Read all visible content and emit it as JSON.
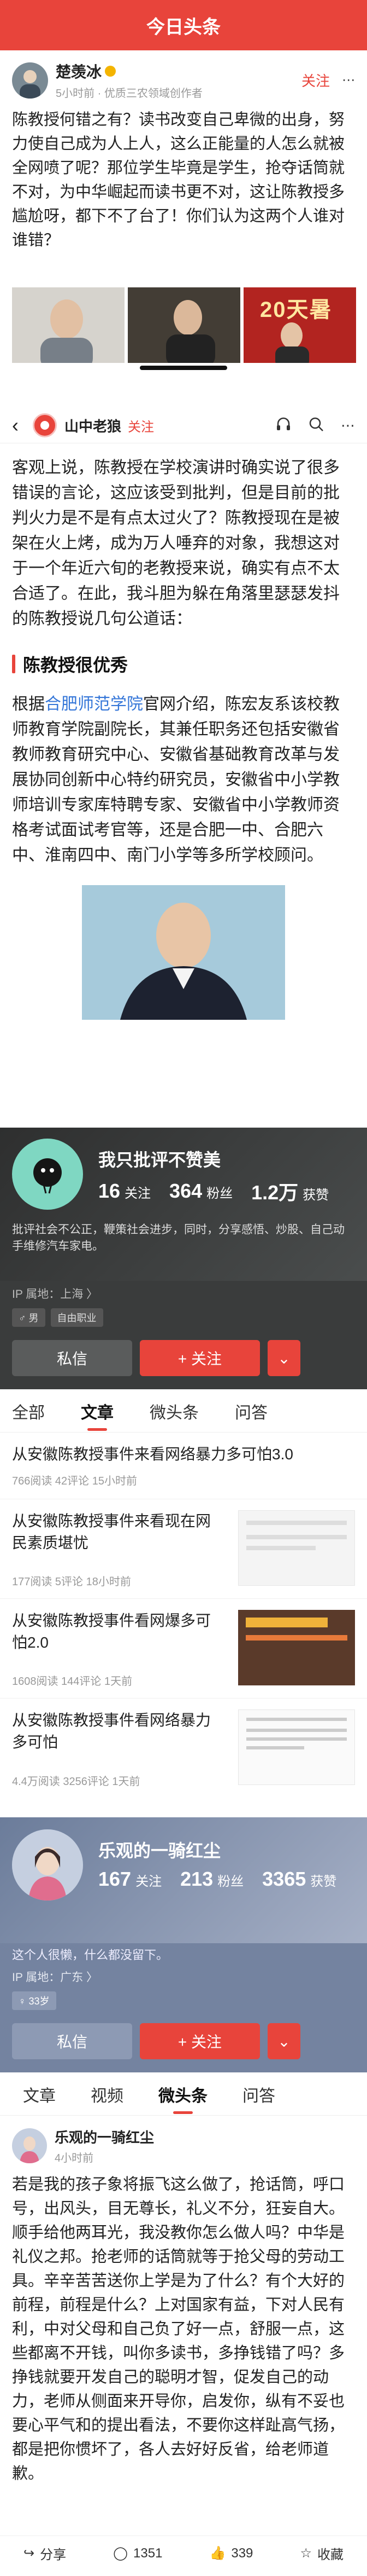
{
  "s1": {
    "app_title": "今日头条",
    "author": {
      "name": "楚羡冰",
      "meta": "5小时前 · 优质三农领域创作者",
      "follow": "关注"
    },
    "post": "陈教授何错之有？读书改变自己卑微的出身，努力使自己成为人上人，这么正能量的人怎么就被全网喷了呢？那位学生毕竟是学生，抢夺话筒就不对，为中华崛起而读书更不对，这让陈教授多尴尬呀，都下不了台了！你们认为这两个人谁对谁错？",
    "thumb3_text": "20天暑"
  },
  "s2": {
    "channel": "山中老狼",
    "follow": "关注",
    "p1": "客观上说，陈教授在学校演讲时确实说了很多错误的言论，这应该受到批判，但是目前的批判火力是不是有点太过火了？陈教授现在是被架在火上烤，成为万人唾弃的对象，我想这对于一个年近六旬的老教授来说，确实有点不太合适了。在此，我斗胆为躲在角落里瑟瑟发抖的陈教授说几句公道话：",
    "section": "陈教授很优秀",
    "p2a": "根据",
    "p2link": "合肥师范学院",
    "p2b": "官网介绍，陈宏友系该校教师教育学院副院长，其兼任职务还包括安徽省教师教育研究中心、安徽省基础教育改革与发展协同创新中心特约研究员，安徽省中小学教师培训专家库特聘专家、安徽省中小学教师资格考试面试考官等，还是合肥一中、合肥六中、淮南四中、南门小学等多所学校顾问。"
  },
  "s3": {
    "name": "我只批评不赞美",
    "stats": [
      {
        "n": "16",
        "l": "关注"
      },
      {
        "n": "364",
        "l": "粉丝"
      },
      {
        "n": "1.2万",
        "l": "获赞"
      }
    ],
    "bio": "批评社会不公正，鞭策社会进步，同时，分享感悟、炒股、自己动手维修汽车家电。",
    "ip": "IP 属地：上海 〉",
    "tag1": "男",
    "tag2": "自由职业",
    "msg": "私信",
    "follow": "+ 关注",
    "tabs": [
      "全部",
      "文章",
      "微头条",
      "问答"
    ],
    "articles": [
      {
        "title": "从安徽陈教授事件来看网络暴力多可怕3.0",
        "meta": "766阅读  42评论  15小时前"
      },
      {
        "title": "从安徽陈教授事件来看现在网民素质堪忧",
        "meta": "177阅读  5评论  18小时前"
      },
      {
        "title": "从安徽陈教授事件看网爆多可怕2.0",
        "meta": "1608阅读  144评论  1天前"
      },
      {
        "title": "从安徽陈教授事件看网络暴力多可怕",
        "meta": "4.4万阅读  3256评论  1天前"
      }
    ]
  },
  "s4": {
    "name": "乐观的一骑红尘",
    "stats": [
      {
        "n": "167",
        "l": "关注"
      },
      {
        "n": "213",
        "l": "粉丝"
      },
      {
        "n": "3365",
        "l": "获赞"
      }
    ],
    "bio": "这个人很懒，什么都没留下。",
    "ip": "IP 属地：广东 〉",
    "tag": "33岁",
    "msg": "私信",
    "follow": "+ 关注",
    "tabs": [
      "文章",
      "视频",
      "微头条",
      "问答"
    ],
    "post_author": "乐观的一骑红尘",
    "post_time": "4小时前",
    "post": "若是我的孩子象将振飞这么做了，抢话筒，呼口号，出风头，目无尊长，礼义不分，狂妄自大。顺手给他两耳光，我没教你怎么做人吗？中华是礼仪之邦。抢老师的话筒就等于抢父母的劳动工具。辛辛苦苦送你上学是为了什么？有个大好的前程，前程是什么？上对国家有益，下对人民有利，中对父母和自己负了好一点，舒服一点，这些都离不开钱，叫你多读书，多挣钱错了吗？多挣钱就要开发自己的聪明才智，促发自己的动力，老师从侧面来开导你，启发你，纵有不妥也要心平气和的提出看法，不要你这样趾高气扬，都是把你惯坏了，各人去好好反省，给老师道歉。",
    "actions": {
      "share": "分享",
      "comment": "1351",
      "like": "339",
      "fav": "收藏"
    }
  }
}
